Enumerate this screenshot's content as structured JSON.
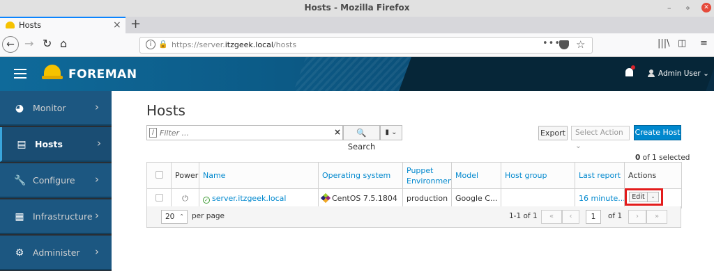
{
  "browser": {
    "window_title": "Hosts - Mozilla Firefox",
    "tab_label": "Hosts",
    "url_prefix": "https://server.",
    "url_domain": "itzgeek.local",
    "url_path": "/hosts"
  },
  "header": {
    "brand": "FOREMAN",
    "user": "Admin User ⌄"
  },
  "sidebar": {
    "items": [
      {
        "label": "Monitor"
      },
      {
        "label": "Hosts"
      },
      {
        "label": "Configure"
      },
      {
        "label": "Infrastructure"
      },
      {
        "label": "Administer"
      }
    ]
  },
  "main": {
    "title": "Hosts",
    "filter_placeholder": "Filter ...",
    "search_label": "Search",
    "export_label": "Export",
    "select_action_label": "Select Action ⌄",
    "create_host_label": "Create Host",
    "selected_count": "0",
    "selected_total": "of 1 selected",
    "table": {
      "headers": [
        "",
        "Power",
        "Name",
        "Operating system",
        "Puppet Environment",
        "Model",
        "Host group",
        "Last report",
        "Actions"
      ],
      "rows": [
        {
          "name": "server.itzgeek.local",
          "os": "CentOS 7.5.1804",
          "environment": "production",
          "model": "Google C...",
          "host_group": "",
          "last_report": "16 minute...",
          "edit_label": "Edit"
        }
      ]
    },
    "pagination": {
      "per_page": "20",
      "per_page_label": "per page",
      "range": "1-1 of 1",
      "page": "1",
      "of_pages": "of 1"
    }
  }
}
